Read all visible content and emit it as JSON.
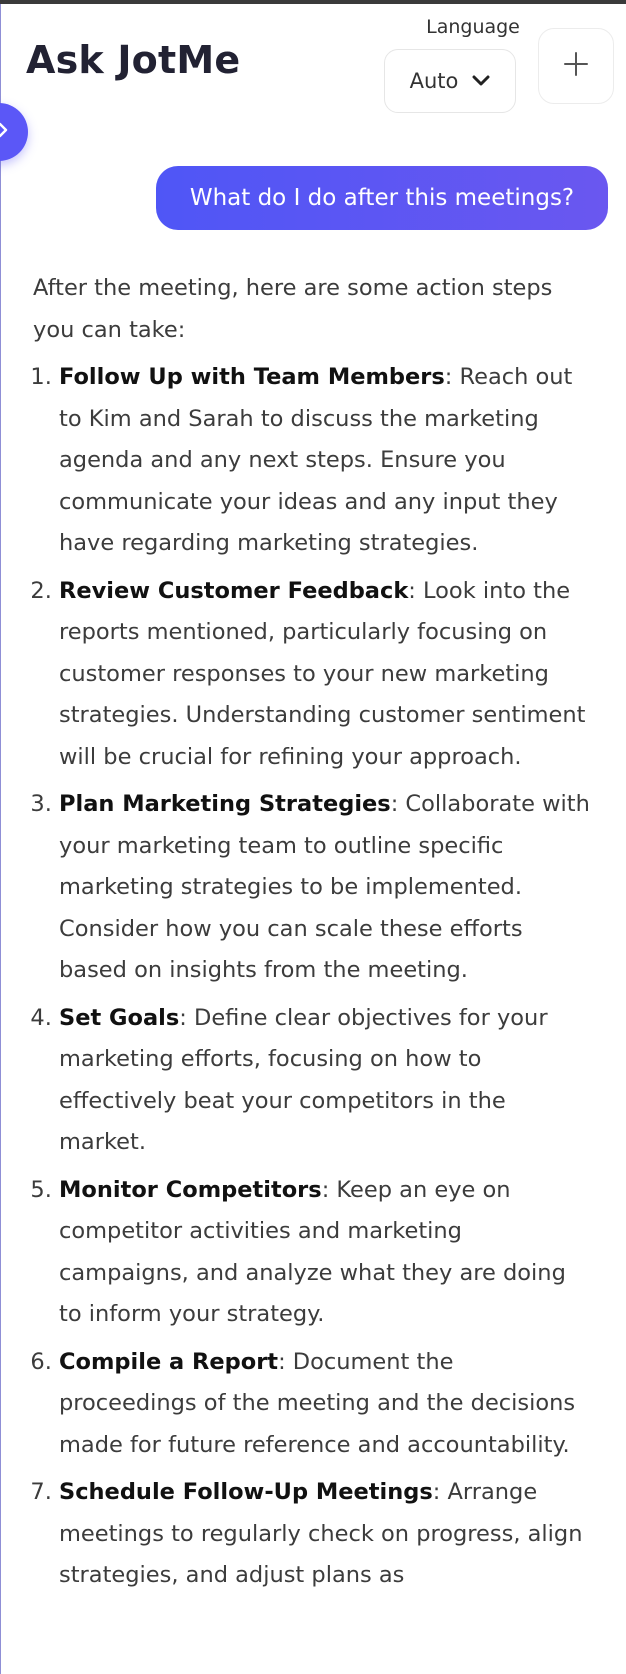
{
  "header": {
    "title": "Ask JotMe",
    "language_label": "Language",
    "language_value": "Auto"
  },
  "conversation": {
    "user_message": "What do I do after this meetings?",
    "answer_intro": "After the meeting, here are some action steps you can take:",
    "steps": [
      {
        "number": "1.",
        "title": "Follow Up with Team Members",
        "text": ": Reach out to Kim and Sarah to discuss the marketing agenda and any next steps. Ensure you communicate your ideas and any input they have regarding marketing strategies."
      },
      {
        "number": "2.",
        "title": "Review Customer Feedback",
        "text": ": Look into the reports mentioned, particularly focusing on customer responses to your new marketing strategies. Understanding customer sentiment will be crucial for refining your approach."
      },
      {
        "number": "3.",
        "title": "Plan Marketing Strategies",
        "text": ": Collaborate with your marketing team to outline specific marketing strategies to be implemented. Consider how you can scale these efforts based on insights from the meeting."
      },
      {
        "number": "4.",
        "title": "Set Goals",
        "text": ": Define clear objectives for your marketing efforts, focusing on how to effectively beat your competitors in the market."
      },
      {
        "number": "5.",
        "title": "Monitor Competitors",
        "text": ": Keep an eye on competitor activities and marketing campaigns, and analyze what they are doing to inform your strategy."
      },
      {
        "number": "6.",
        "title": "Compile a Report",
        "text": ": Document the proceedings of the meeting and the decisions made for future reference and accountability."
      },
      {
        "number": "7.",
        "title": "Schedule Follow-Up Meetings",
        "text": ": Arrange meetings to regularly check on progress, align strategies, and adjust plans as"
      }
    ]
  },
  "colors": {
    "accent": "#5b57f7",
    "bubble_start": "#4f56f6",
    "bubble_end": "#6a57f0"
  },
  "icons": {
    "language_dropdown": "chevron-down-icon",
    "new_chat": "plus-icon",
    "sidebar_toggle": "chevron-right-icon"
  }
}
